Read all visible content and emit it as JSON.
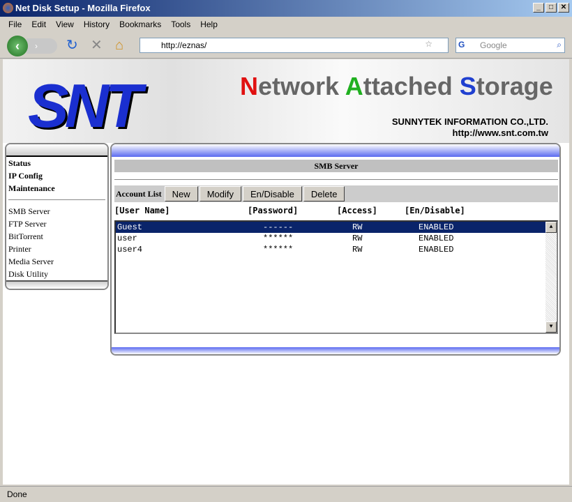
{
  "window": {
    "title": "Net Disk Setup - Mozilla Firefox"
  },
  "menu": [
    "File",
    "Edit",
    "View",
    "History",
    "Bookmarks",
    "Tools",
    "Help"
  ],
  "nav": {
    "url": "http://eznas/",
    "search_placeholder": "Google"
  },
  "banner": {
    "logo": "SNT",
    "tagline": [
      "N",
      "etwork ",
      "A",
      "ttached ",
      "S",
      "torage"
    ],
    "company": "SUNNYTEK INFORMATION CO.,LTD.",
    "website": "http://www.snt.com.tw"
  },
  "sidebar": {
    "top": [
      "Status",
      "IP Config",
      "Maintenance"
    ],
    "services": [
      "SMB Server",
      "FTP Server",
      "BitTorrent",
      "Printer",
      "Media Server",
      "Disk Utility"
    ]
  },
  "panel": {
    "title": "SMB Server",
    "account_list_label": "Account List",
    "buttons": [
      "New",
      "Modify",
      "En/Disable",
      "Delete"
    ],
    "columns": [
      "[User Name]",
      "[Password]",
      "[Access]",
      "[En/Disable]"
    ],
    "rows": [
      [
        "Guest",
        "------",
        "RW",
        "ENABLED"
      ],
      [
        "user",
        "******",
        "RW",
        "ENABLED"
      ],
      [
        "user4",
        "******",
        "RW",
        "ENABLED"
      ]
    ],
    "selected_row": 0
  },
  "status": "Done"
}
